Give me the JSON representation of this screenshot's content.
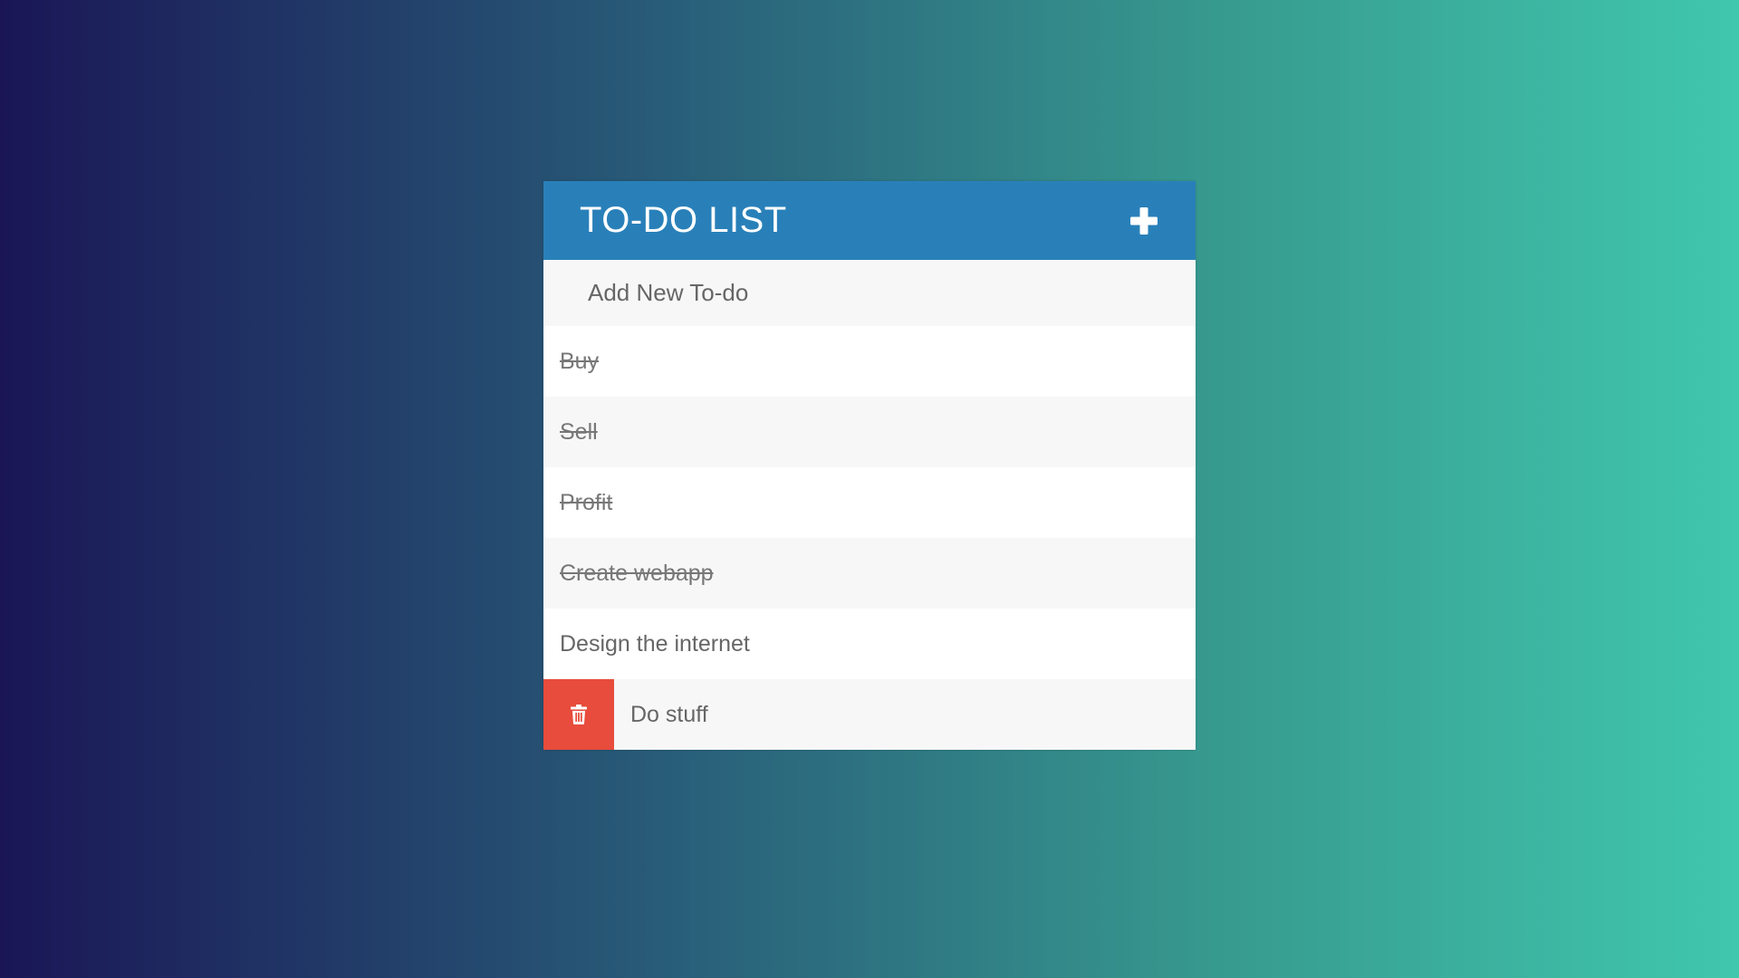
{
  "header": {
    "title": "TO-DO LIST",
    "add_icon": "plus-icon"
  },
  "new_todo": {
    "placeholder": "Add New To-do",
    "value": ""
  },
  "todos": [
    {
      "text": "Buy",
      "completed": true
    },
    {
      "text": "Sell",
      "completed": true
    },
    {
      "text": "Profit",
      "completed": true
    },
    {
      "text": "Create webapp",
      "completed": true
    },
    {
      "text": "Design the internet",
      "completed": false
    },
    {
      "text": "Do stuff",
      "completed": false,
      "hovered": true,
      "delete_icon": "trash-icon"
    }
  ],
  "colors": {
    "header": "#2980b9",
    "delete": "#e74c3c",
    "gradient_start": "#1a1656",
    "gradient_end": "#40c7ad"
  }
}
